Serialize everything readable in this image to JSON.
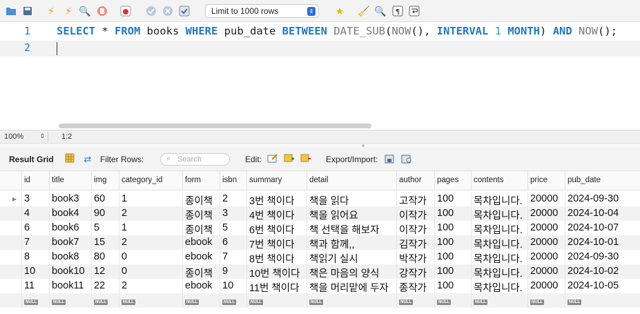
{
  "toolbar": {
    "limit_label": "Limit to 1000 rows",
    "icons": [
      "open-folder-icon",
      "save-icon",
      "execute-icon",
      "execute-current-icon",
      "explain-icon",
      "stop-icon",
      "toggle-continue-icon",
      "commit-icon",
      "rollback-icon",
      "autocommit-icon",
      "add-snippet-icon",
      "beautify-icon",
      "find-icon",
      "invisible-chars-icon",
      "wrap-icon"
    ]
  },
  "editor": {
    "line_numbers": [
      "1",
      "2"
    ],
    "sql": {
      "t1": "SELECT",
      "t2": " * ",
      "t3": "FROM",
      "t4": " books ",
      "t5": "WHERE",
      "t6": " pub_date ",
      "t7": "BETWEEN",
      "t8": " ",
      "t9": "DATE_SUB",
      "t10": "(",
      "t11": "NOW",
      "t12": "(), ",
      "t13": "INTERVAL",
      "t14": " ",
      "t15": "1",
      "t16": " ",
      "t17": "MONTH",
      "t18": ") ",
      "t19": "AND",
      "t20": " ",
      "t21": "NOW",
      "t22": "();"
    }
  },
  "status": {
    "zoom": "100%",
    "cursor": "1:2"
  },
  "result_toolbar": {
    "title": "Result Grid",
    "filter_label": "Filter Rows:",
    "search_placeholder": "Search",
    "edit_label": "Edit:",
    "export_label": "Export/Import:"
  },
  "grid": {
    "columns": [
      "id",
      "title",
      "img",
      "category_id",
      "form",
      "isbn",
      "summary",
      "detail",
      "author",
      "pages",
      "contents",
      "price",
      "pub_date"
    ],
    "rows": [
      [
        "3",
        "book3",
        "60",
        "1",
        "종이책",
        "2",
        "3번 책이다",
        "책을 읽다",
        "고작가",
        "100",
        "목차입니다.",
        "20000",
        "2024-09-30"
      ],
      [
        "4",
        "book4",
        "90",
        "2",
        "종이책",
        "3",
        "4번 책이다",
        "책을 읽어요",
        "이작가",
        "100",
        "목차입니다.",
        "20000",
        "2024-10-04"
      ],
      [
        "6",
        "book6",
        "5",
        "1",
        "종이책",
        "5",
        "6번 책이다",
        "책 선택을 해보자",
        "이작가",
        "100",
        "목차입니다.",
        "20000",
        "2024-10-07"
      ],
      [
        "7",
        "book7",
        "15",
        "2",
        "ebook",
        "6",
        "7번 책이다",
        "책과 함께,,",
        "김작가",
        "100",
        "목차입니다.",
        "20000",
        "2024-10-01"
      ],
      [
        "8",
        "book8",
        "80",
        "0",
        "ebook",
        "7",
        "8번 책이다",
        "책읽기 실시",
        "박작가",
        "100",
        "목차입니다.",
        "20000",
        "2024-09-30"
      ],
      [
        "10",
        "book10",
        "12",
        "0",
        "종이책",
        "9",
        "10번 책이다",
        "책은 마음의 양식",
        "강작가",
        "100",
        "목차입니다.",
        "20000",
        "2024-10-02"
      ],
      [
        "11",
        "book11",
        "22",
        "2",
        "ebook",
        "10",
        "11번 책이다",
        "책을 머리맡에 두자",
        "종작가",
        "100",
        "목차입니다.",
        "20000",
        "2024-10-05"
      ]
    ],
    "null_label": "NULL"
  }
}
